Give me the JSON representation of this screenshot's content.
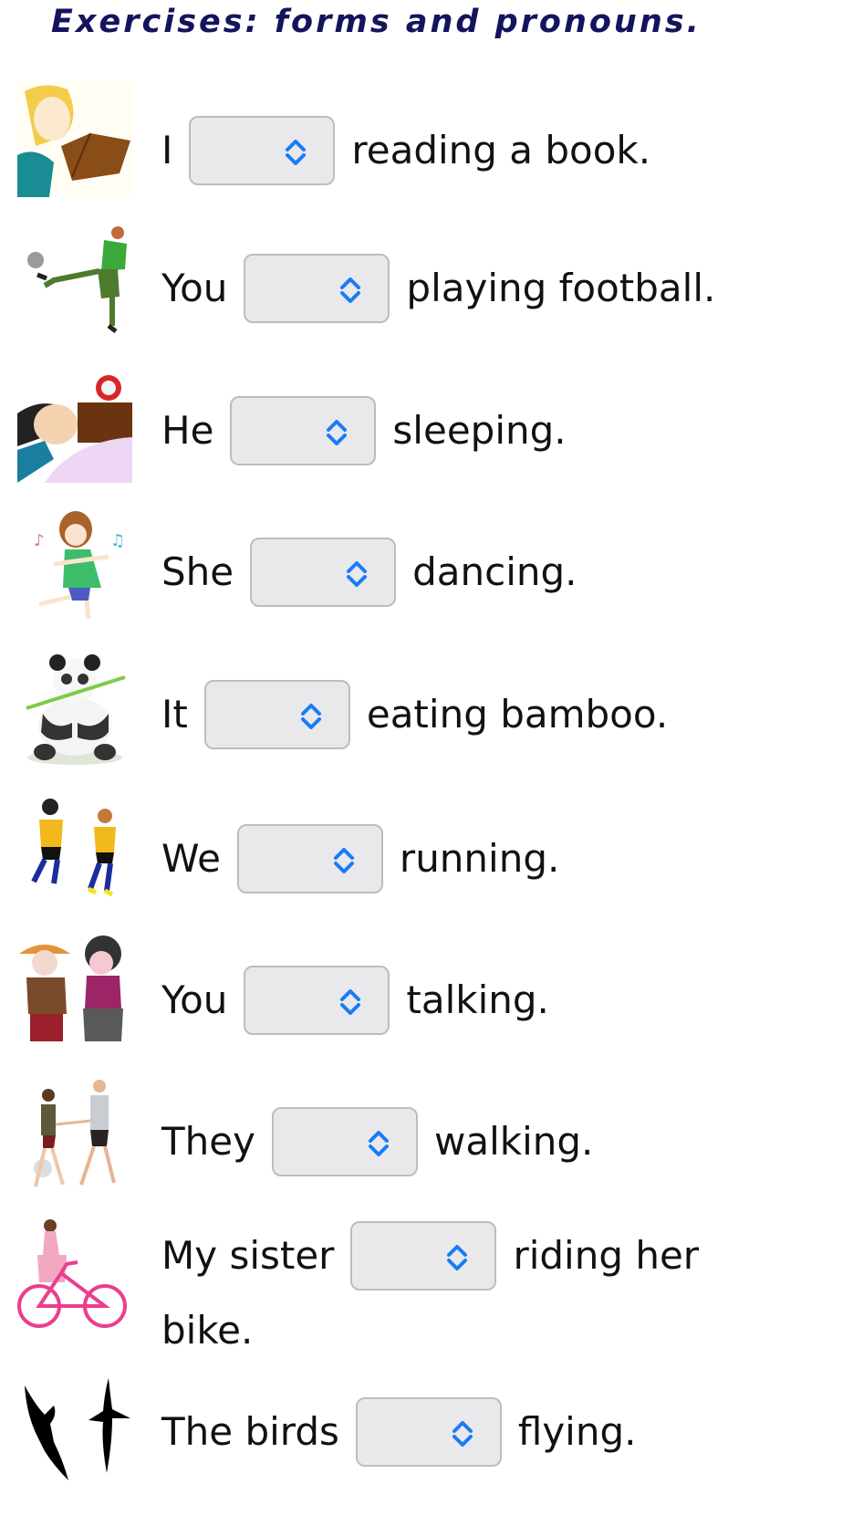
{
  "title": "Exercises: forms and pronouns.",
  "accent_color": "#1a7cf5",
  "items": [
    {
      "image": "woman-reading-book",
      "subject": "I",
      "rest": "reading a book.",
      "selected": ""
    },
    {
      "image": "boy-kicking-football",
      "subject": "You",
      "rest": "playing football.",
      "selected": ""
    },
    {
      "image": "boy-sleeping-in-bed",
      "subject": "He",
      "rest": "sleeping.",
      "selected": ""
    },
    {
      "image": "girl-dancing",
      "subject": "She",
      "rest": "dancing.",
      "selected": ""
    },
    {
      "image": "panda-eating-bamboo",
      "subject": "It",
      "rest": "eating bamboo.",
      "selected": ""
    },
    {
      "image": "two-boys-running",
      "subject": "We",
      "rest": "running.",
      "selected": ""
    },
    {
      "image": "two-people-talking",
      "subject": "You",
      "rest": "talking.",
      "selected": ""
    },
    {
      "image": "couple-walking",
      "subject": "They",
      "rest": "walking.",
      "selected": ""
    },
    {
      "image": "girl-riding-bike",
      "subject": "My sister",
      "rest": "riding her",
      "rest_line2": "bike.",
      "selected": ""
    },
    {
      "image": "birds-flying",
      "subject": "The birds",
      "rest": "flying.",
      "selected": ""
    }
  ]
}
